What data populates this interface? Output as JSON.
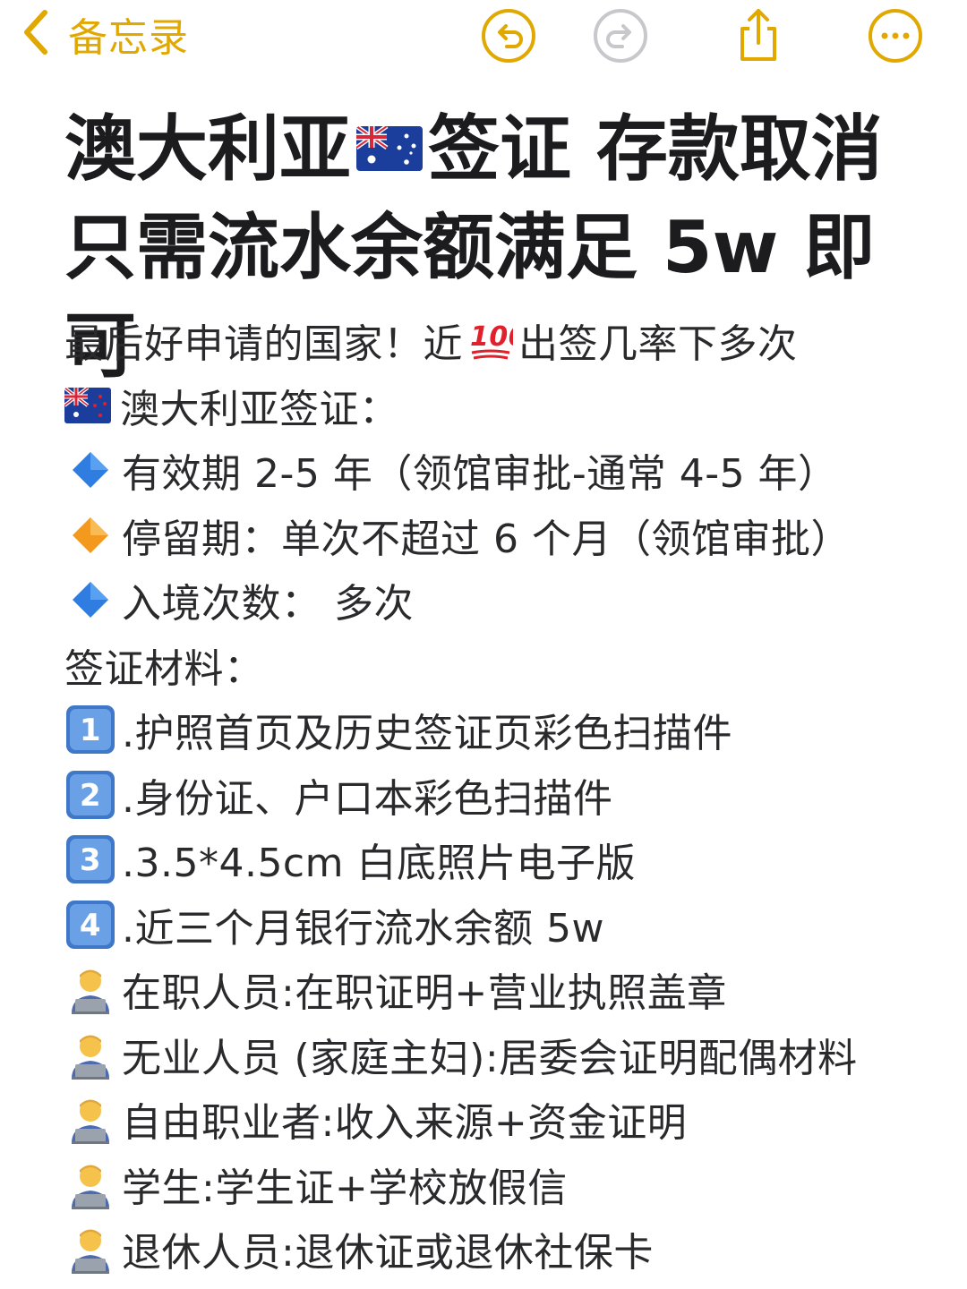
{
  "nav": {
    "back_label": "备忘录",
    "accent_color": "#e0a800",
    "icons": [
      "chevron-left-icon",
      "undo-icon",
      "redo-icon",
      "share-icon",
      "more-icon"
    ]
  },
  "note": {
    "title": {
      "line1_a": "澳大利亚",
      "line1_b": "签证 存款取消",
      "line2": "只需流水余额满足 5w 即可"
    },
    "intro": {
      "part1": "最后好申请的国家！近",
      "part2": "出签几率下多次"
    },
    "visa_heading": "澳大利亚签证：",
    "validity": "有效期 2-5 年（领馆审批-通常 4-5 年）",
    "stay": "停留期：单次不超过 6 个月（领馆审批）",
    "entries": "入境次数： 多次",
    "materials_heading": "签证材料：",
    "materials": [
      ".护照首页及历史签证页彩色扫描件",
      ".身份证、户口本彩色扫描件",
      ".3.5*4.5cm 白底照片电子版",
      ".近三个月银行流水余额 5w"
    ],
    "personnel": [
      "在职人员:在职证明+营业执照盖章",
      "无业人员 (家庭主妇):居委会证明配偶材料",
      "自由职业者:收入来源+资金证明",
      "学生:学生证+学校放假信",
      "退休人员:退休证或退休社保卡"
    ]
  }
}
